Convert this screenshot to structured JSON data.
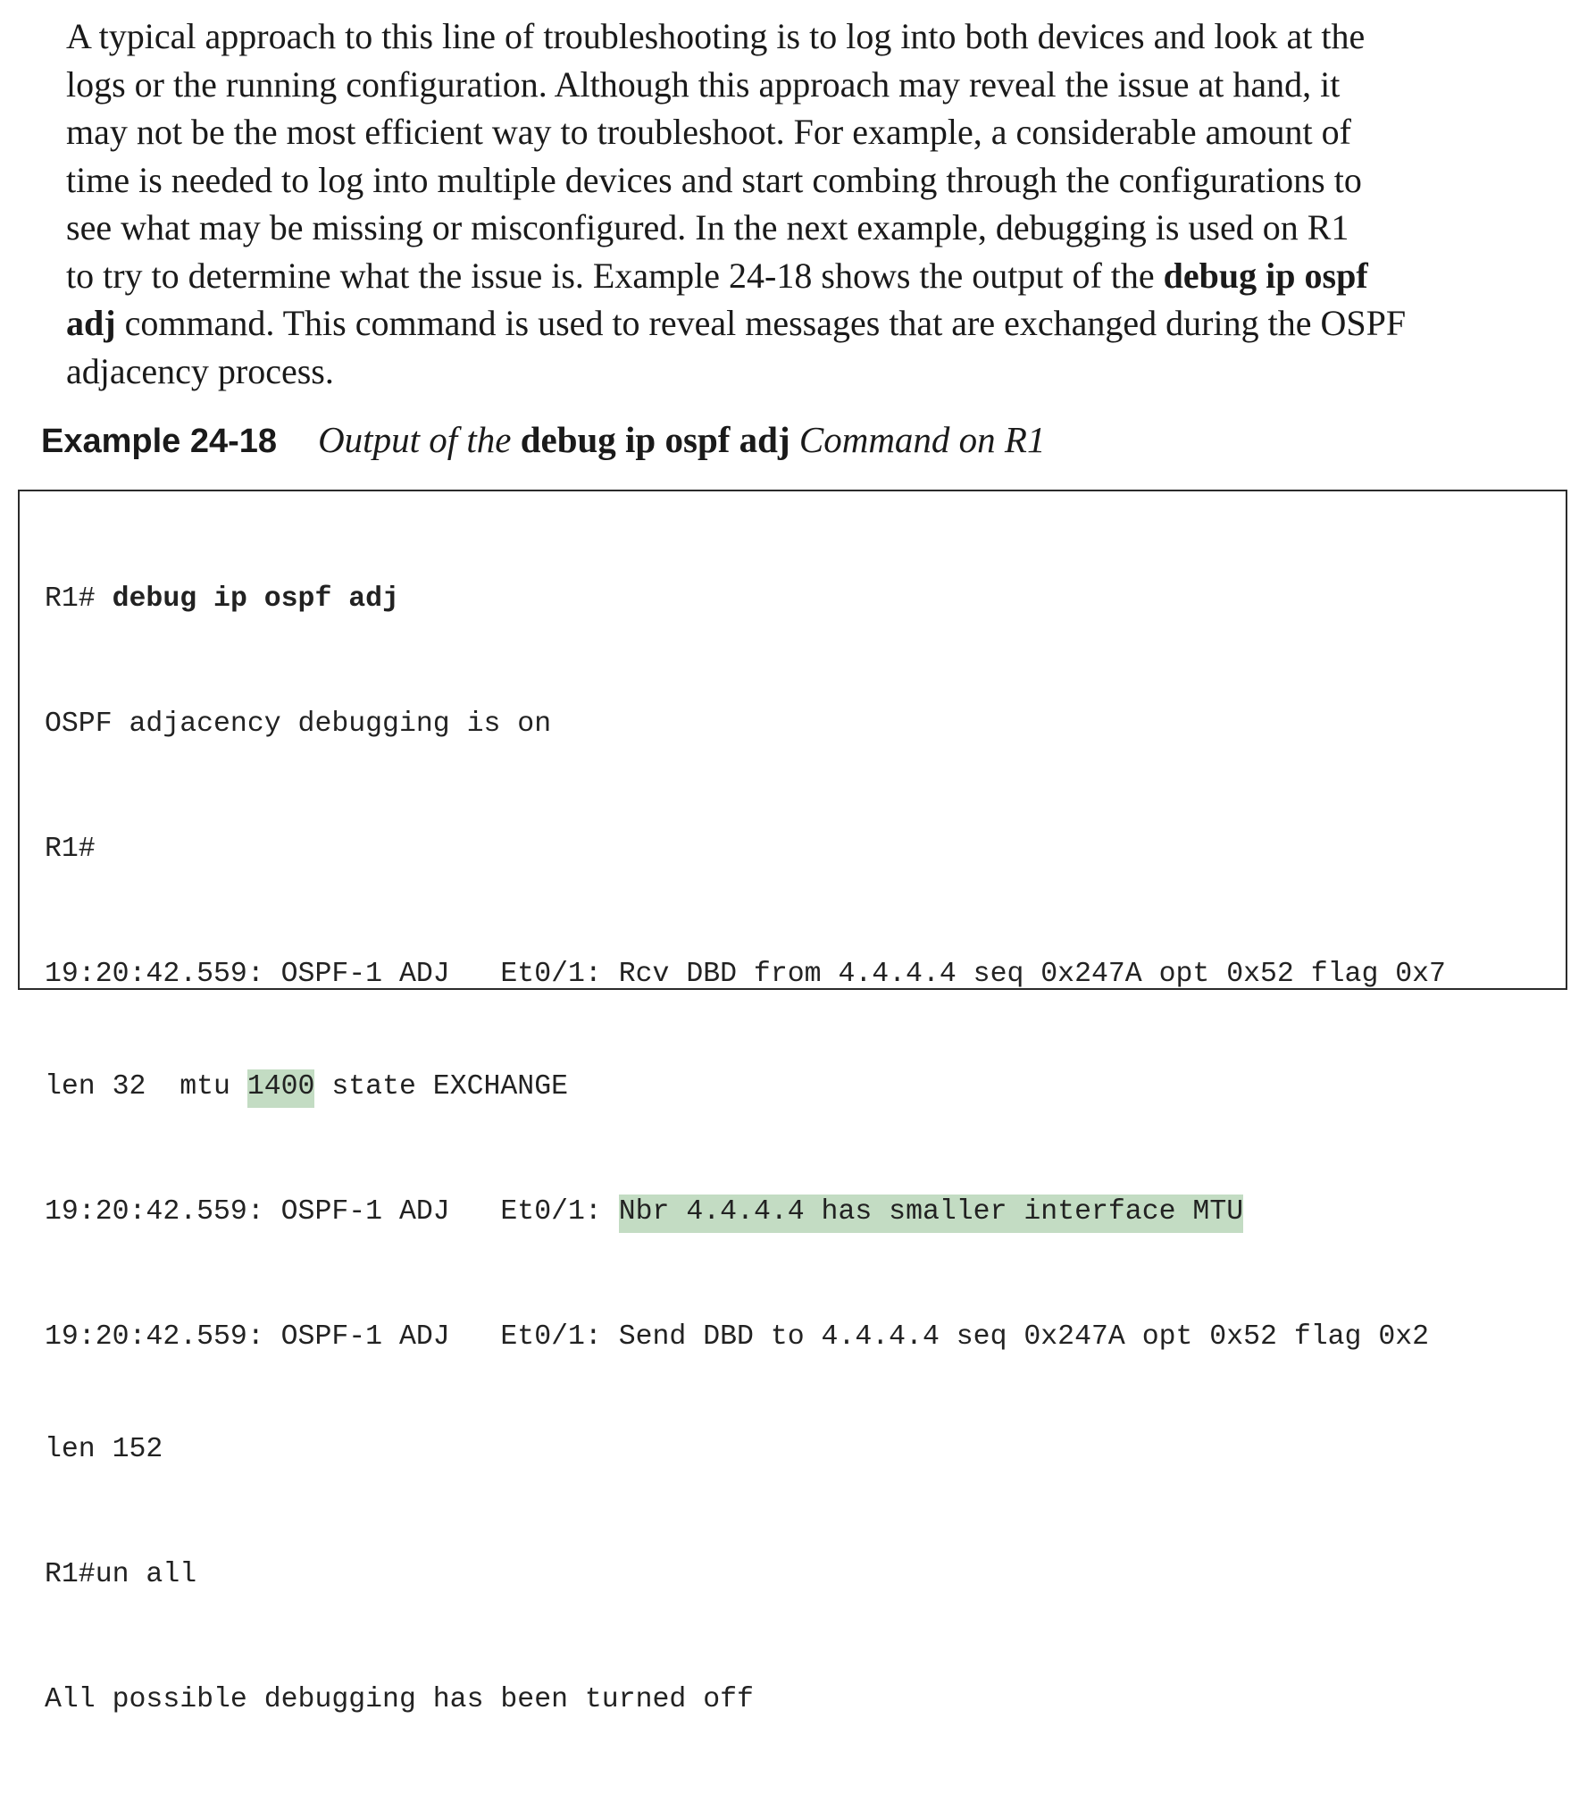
{
  "paragraph": {
    "l1": "A typical approach to this line of troubleshooting is to log into both devices and look at the",
    "l2": "logs or the running configuration. Although this approach may reveal the issue at hand, it",
    "l3": "may not be the most efficient way to troubleshoot. For example, a considerable amount of",
    "l4": "time is needed to log into multiple devices and start combing through the configurations to",
    "l5": "see what may be missing or misconfigured. In the next example, debugging is used on R1",
    "l6_pre": "to try to determine what the issue is. Example 24-18 shows the output of the ",
    "l6_cmd": "debug ip ospf",
    "l7_cmd": "adj",
    "l7_post": " command. This command is used to reveal messages that are exchanged during the OSPF",
    "l8": "adjacency process."
  },
  "caption": {
    "label": "Example 24-18",
    "pre": "Output of the ",
    "cmd": "debug ip ospf adj",
    "post": " Command on R1"
  },
  "code": {
    "c1_prompt": "R1# ",
    "c1_cmd": "debug ip ospf adj",
    "c2": "OSPF adjacency debugging is on",
    "c3": "R1#",
    "c4a": "19:20:42.559: OSPF-1 ADJ   Et0/1: Rcv DBD from 4.4.4.4 seq 0x247A opt 0x52 flag 0x7",
    "c4b_pre": "len 32  mtu ",
    "c4b_hl": "1400",
    "c4b_post": " state EXCHANGE",
    "c5_pre": "19:20:42.559: OSPF-1 ADJ   Et0/1: ",
    "c5_hl": "Nbr 4.4.4.4 has smaller interface MTU",
    "c6a": "19:20:42.559: OSPF-1 ADJ   Et0/1: Send DBD to 4.4.4.4 seq 0x247A opt 0x52 flag 0x2",
    "c6b": "len 152",
    "c7": "R1#un all",
    "c8": "All possible debugging has been turned off"
  },
  "colors": {
    "highlight": "#c3dcc3",
    "text": "#1a1a1a",
    "border": "#2b2b2b"
  }
}
